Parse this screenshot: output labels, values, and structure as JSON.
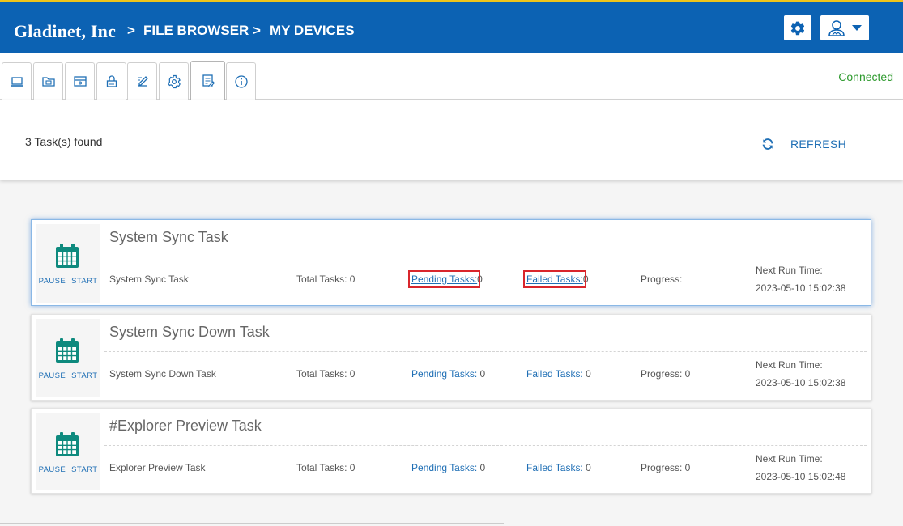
{
  "header": {
    "brand": "Gladinet, Inc",
    "breadcrumb": [
      {
        "sep": ">",
        "label": "FILE BROWSER"
      },
      {
        "sep": ">",
        "label": "MY DEVICES"
      }
    ],
    "settings_icon": "gear-icon",
    "user_icon": "user-dropdown-icon"
  },
  "tabs": [
    {
      "name": "devices",
      "icon": "laptop-icon"
    },
    {
      "name": "folders",
      "icon": "folder-icon"
    },
    {
      "name": "storage",
      "icon": "drive-icon"
    },
    {
      "name": "security",
      "icon": "lock-icon"
    },
    {
      "name": "edit",
      "icon": "edit-icon"
    },
    {
      "name": "settings",
      "icon": "gear-icon"
    },
    {
      "name": "tasks",
      "icon": "task-list-icon",
      "active": true
    },
    {
      "name": "info",
      "icon": "info-icon"
    }
  ],
  "status": {
    "connection": "Connected"
  },
  "toolbar": {
    "found": "3 Task(s) found",
    "refresh_label": "REFRESH"
  },
  "labels": {
    "pause": "PAUSE",
    "start": "START"
  },
  "tasks": [
    {
      "title": "System Sync Task",
      "name": "System Sync Task",
      "total": "Total Tasks: 0",
      "pending_label": "Pending Tasks:",
      "pending_value": "0",
      "failed_label": "Failed Tasks:",
      "failed_value": "0",
      "progress": "Progress:",
      "next_label": "Next Run Time:",
      "next_value": "2023-05-10 15:02:38"
    },
    {
      "title": "System Sync Down Task",
      "name": "System Sync Down Task",
      "total": "Total Tasks: 0",
      "pending_label": "Pending Tasks:",
      "pending_value": "0",
      "failed_label": "Failed Tasks:",
      "failed_value": "0",
      "progress": "Progress: 0",
      "next_label": "Next Run Time:",
      "next_value": "2023-05-10 15:02:38"
    },
    {
      "title": "#Explorer Preview Task",
      "name": "Explorer Preview Task",
      "total": "Total Tasks: 0",
      "pending_label": "Pending Tasks:",
      "pending_value": "0",
      "failed_label": "Failed Tasks:",
      "failed_value": "0",
      "progress": "Progress: 0",
      "next_label": "Next Run Time:",
      "next_value": "2023-05-10 15:02:48"
    }
  ],
  "colors": {
    "header_bg": "#0c62b3",
    "accent_top": "#f0c419",
    "link": "#1f6fb5",
    "calendar": "#0e8a7e",
    "connected": "#2e9a2e",
    "highlight": "#d9262c"
  }
}
